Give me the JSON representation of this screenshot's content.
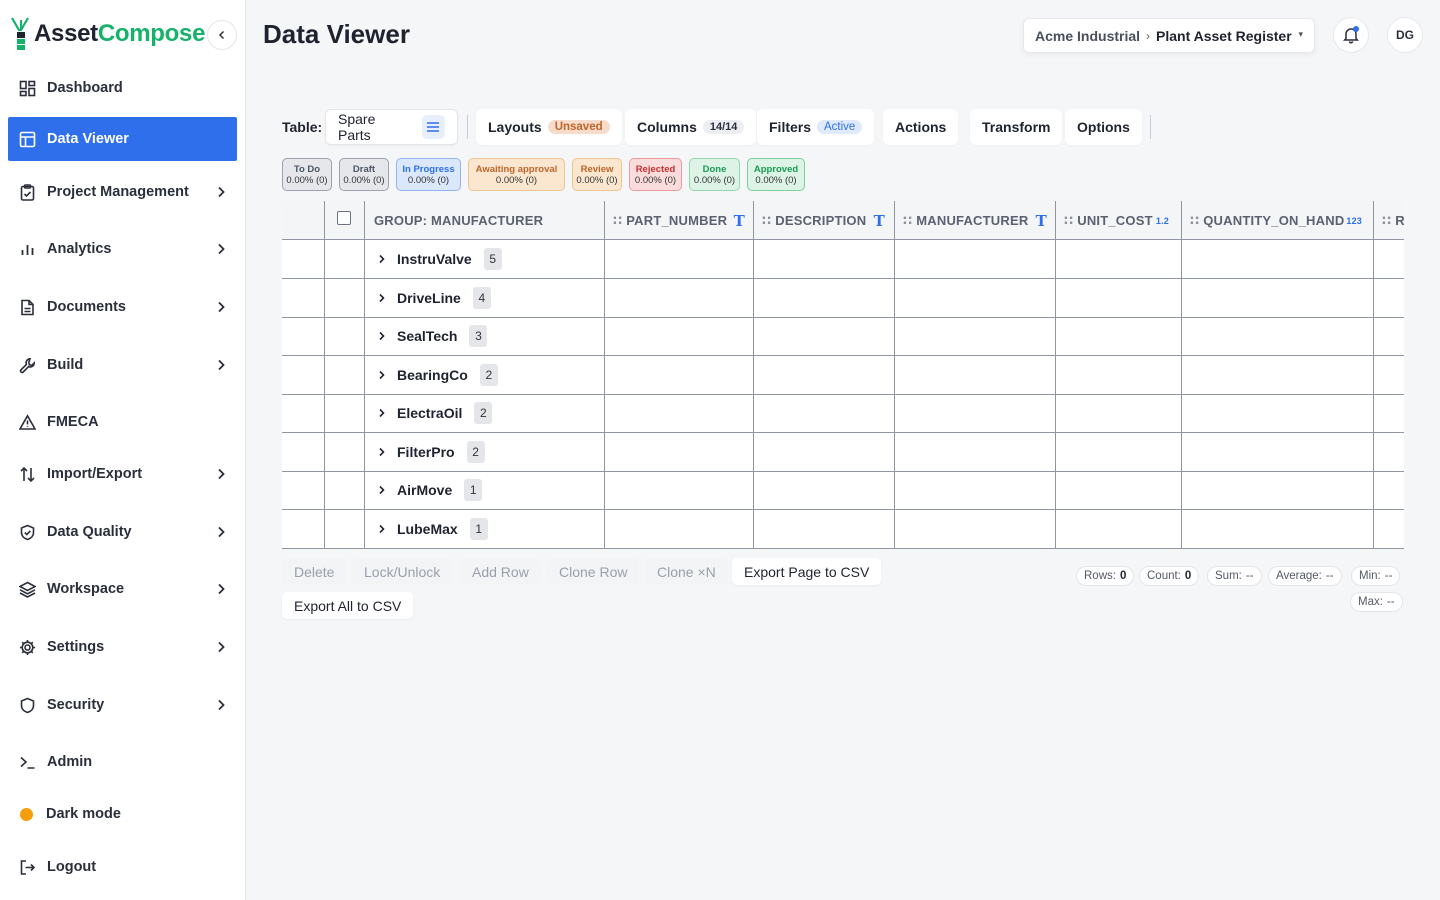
{
  "app": {
    "logo_part1": "Asset",
    "logo_part2": "Compose",
    "brand_color": "#17b26a",
    "accent_color": "#2f6fec"
  },
  "sidebar": {
    "items": [
      {
        "label": "Dashboard",
        "icon": "dashboard-icon",
        "chevron": false,
        "active": false
      },
      {
        "label": "Data Viewer",
        "icon": "table-icon",
        "chevron": false,
        "active": true
      },
      {
        "label": "Project Management",
        "icon": "clipboard-icon",
        "chevron": true,
        "active": false
      },
      {
        "label": "Analytics",
        "icon": "bar-chart-icon",
        "chevron": true,
        "active": false
      },
      {
        "label": "Documents",
        "icon": "document-icon",
        "chevron": true,
        "active": false
      },
      {
        "label": "Build",
        "icon": "wrench-icon",
        "chevron": true,
        "active": false
      },
      {
        "label": "FMECA",
        "icon": "warning-icon",
        "chevron": false,
        "active": false
      },
      {
        "label": "Import/Export",
        "icon": "import-export-icon",
        "chevron": true,
        "active": false
      },
      {
        "label": "Data Quality",
        "icon": "shield-check-icon",
        "chevron": true,
        "active": false
      },
      {
        "label": "Workspace",
        "icon": "layers-icon",
        "chevron": true,
        "active": false
      },
      {
        "label": "Settings",
        "icon": "gear-icon",
        "chevron": true,
        "active": false
      },
      {
        "label": "Security",
        "icon": "shield-icon",
        "chevron": true,
        "active": false
      },
      {
        "label": "Admin",
        "icon": "terminal-icon",
        "chevron": false,
        "active": false
      },
      {
        "label": "Dark mode",
        "icon": "dark-mode-dot-icon",
        "chevron": false,
        "active": false
      },
      {
        "label": "Logout",
        "icon": "logout-icon",
        "chevron": false,
        "active": false
      }
    ]
  },
  "header": {
    "title": "Data Viewer",
    "org": "Acme Industrial",
    "project": "Plant Asset Register",
    "avatar_initials": "DG"
  },
  "toolbar": {
    "table_label": "Table:",
    "table_value": "Spare Parts",
    "layouts_label": "Layouts",
    "layouts_badge": "Unsaved",
    "columns_label": "Columns",
    "columns_badge": "14/14",
    "filters_label": "Filters",
    "filters_badge": "Active",
    "actions_label": "Actions",
    "transform_label": "Transform",
    "options_label": "Options"
  },
  "statuses": [
    {
      "label": "To Do",
      "value": "0.00% (0)",
      "bg": "#e5e7eb",
      "border": "#9ca3af",
      "color": "#4b5563"
    },
    {
      "label": "Draft",
      "value": "0.00% (0)",
      "bg": "#e5e7eb",
      "border": "#9ca3af",
      "color": "#4b5563"
    },
    {
      "label": "In Progress",
      "value": "0.00% (0)",
      "bg": "#dbe7fb",
      "border": "#93b4f0",
      "color": "#2f6fec"
    },
    {
      "label": "Awaiting approval",
      "value": "0.00% (0)",
      "bg": "#fbe7cf",
      "border": "#eec48f",
      "color": "#c0652a"
    },
    {
      "label": "Review",
      "value": "0.00% (0)",
      "bg": "#fbe7cf",
      "border": "#eec48f",
      "color": "#c0652a"
    },
    {
      "label": "Rejected",
      "value": "0.00% (0)",
      "bg": "#fadcdc",
      "border": "#ee9b9b",
      "color": "#c93030"
    },
    {
      "label": "Done",
      "value": "0.00% (0)",
      "bg": "#dcf3e5",
      "border": "#94d7ad",
      "color": "#1b9a55"
    },
    {
      "label": "Approved",
      "value": "0.00% (0)",
      "bg": "#dcf3e5",
      "border": "#7fcf9a",
      "color": "#1b9a55"
    }
  ],
  "grid": {
    "group_header": "GROUP: MANUFACTURER",
    "columns": [
      {
        "label": "PART_NUMBER",
        "type_icon": "T"
      },
      {
        "label": "DESCRIPTION",
        "type_icon": "T"
      },
      {
        "label": "MANUFACTURER",
        "type_icon": "T"
      },
      {
        "label": "UNIT_COST",
        "type_icon": "1.2"
      },
      {
        "label": "QUANTITY_ON_HAND",
        "type_icon": "123"
      },
      {
        "label": "R",
        "type_icon": ""
      }
    ],
    "groups": [
      {
        "name": "InstruValve",
        "count": "5"
      },
      {
        "name": "DriveLine",
        "count": "4"
      },
      {
        "name": "SealTech",
        "count": "3"
      },
      {
        "name": "BearingCo",
        "count": "2"
      },
      {
        "name": "ElectraOil",
        "count": "2"
      },
      {
        "name": "FilterPro",
        "count": "2"
      },
      {
        "name": "AirMove",
        "count": "1"
      },
      {
        "name": "LubeMax",
        "count": "1"
      }
    ]
  },
  "actions": {
    "delete": "Delete",
    "lock": "Lock/Unlock",
    "add_row": "Add Row",
    "clone_row": "Clone Row",
    "clone_n": "Clone ×N",
    "export_page": "Export Page to CSV",
    "export_all": "Export All to CSV"
  },
  "stats": {
    "rows_label": "Rows:",
    "rows_value": "0",
    "count_label": "Count:",
    "count_value": "0",
    "sum_label": "Sum:",
    "sum_value": "--",
    "avg_label": "Average:",
    "avg_value": "--",
    "min_label": "Min:",
    "min_value": "--",
    "max_label": "Max:",
    "max_value": "--"
  }
}
